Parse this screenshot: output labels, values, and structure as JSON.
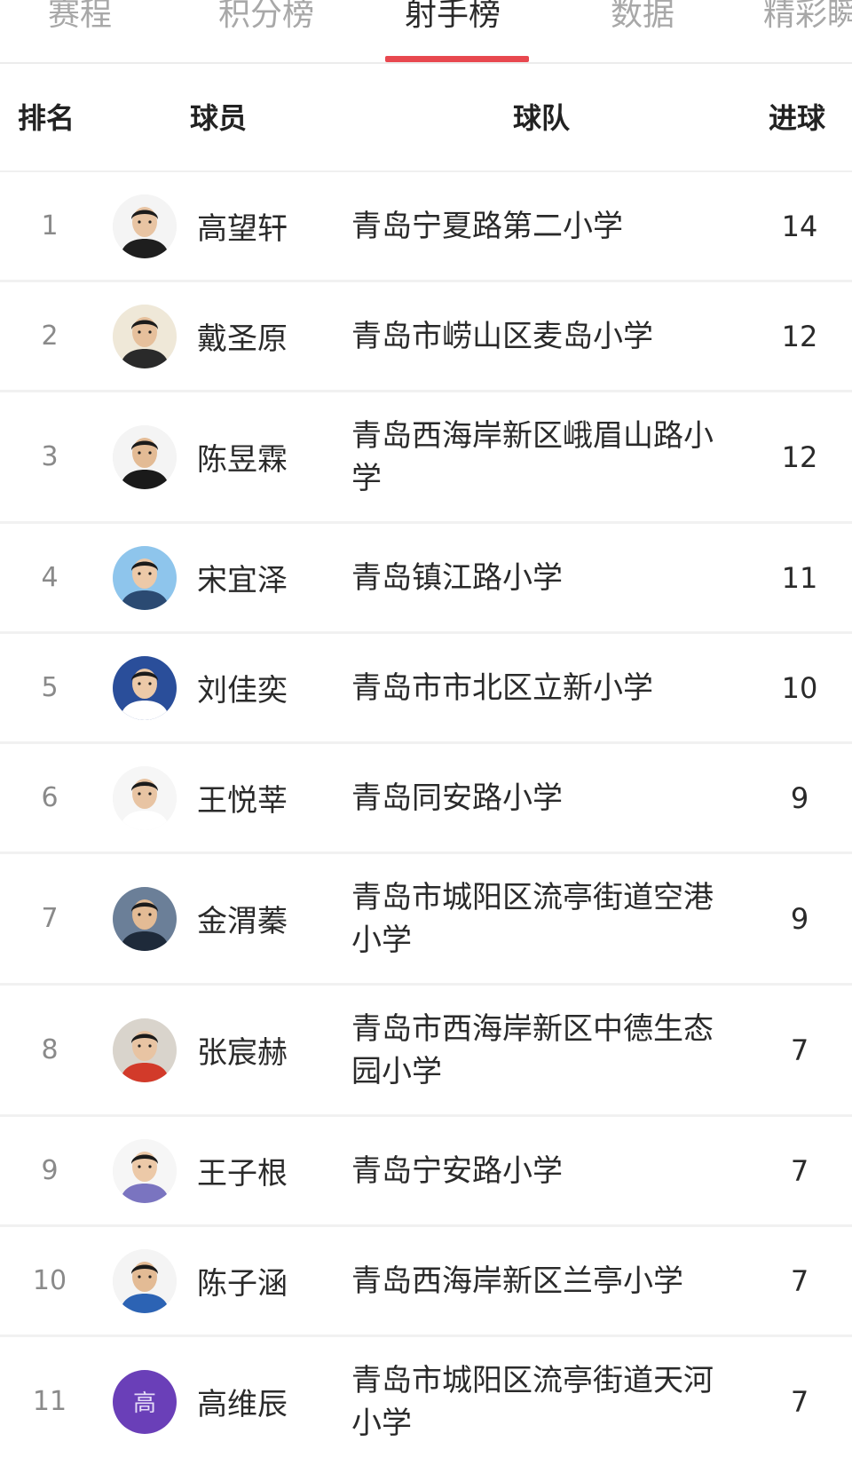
{
  "tabs": [
    {
      "label": "赛程"
    },
    {
      "label": "积分榜"
    },
    {
      "label": "射手榜"
    },
    {
      "label": "数据"
    },
    {
      "label": "精彩瞬"
    }
  ],
  "active_tab": "射手榜",
  "accent_color": "#e8484f",
  "table": {
    "headers": {
      "rank": "排名",
      "player": "球员",
      "team": "球队",
      "goals": "进球"
    },
    "rows": [
      {
        "rank": "1",
        "player": "高望轩",
        "team": "青岛宁夏路第二小学",
        "goals": "14",
        "avatar": "player-photo-icon"
      },
      {
        "rank": "2",
        "player": "戴圣原",
        "team": "青岛市崂山区麦岛小学",
        "goals": "12",
        "avatar": "player-photo-icon"
      },
      {
        "rank": "3",
        "player": "陈昱霖",
        "team": "青岛西海岸新区峨眉山路小学",
        "goals": "12",
        "avatar": "player-photo-icon"
      },
      {
        "rank": "4",
        "player": "宋宜泽",
        "team": "青岛镇江路小学",
        "goals": "11",
        "avatar": "player-photo-icon"
      },
      {
        "rank": "5",
        "player": "刘佳奕",
        "team": "青岛市市北区立新小学",
        "goals": "10",
        "avatar": "player-photo-icon"
      },
      {
        "rank": "6",
        "player": "王悦莘",
        "team": "青岛同安路小学",
        "goals": "9",
        "avatar": "player-photo-icon"
      },
      {
        "rank": "7",
        "player": "金渭蓁",
        "team": "青岛市城阳区流亭街道空港小学",
        "goals": "9",
        "avatar": "player-photo-icon"
      },
      {
        "rank": "8",
        "player": "张宸赫",
        "team": "青岛市西海岸新区中德生态园小学",
        "goals": "7",
        "avatar": "player-photo-icon"
      },
      {
        "rank": "9",
        "player": "王子根",
        "team": "青岛宁安路小学",
        "goals": "7",
        "avatar": "player-photo-icon"
      },
      {
        "rank": "10",
        "player": "陈子涵",
        "team": "青岛西海岸新区兰亭小学",
        "goals": "7",
        "avatar": "player-photo-icon"
      },
      {
        "rank": "11",
        "player": "高维辰",
        "team": "青岛市城阳区流亭街道天河小学",
        "goals": "7",
        "avatar_letter": "高"
      }
    ]
  }
}
